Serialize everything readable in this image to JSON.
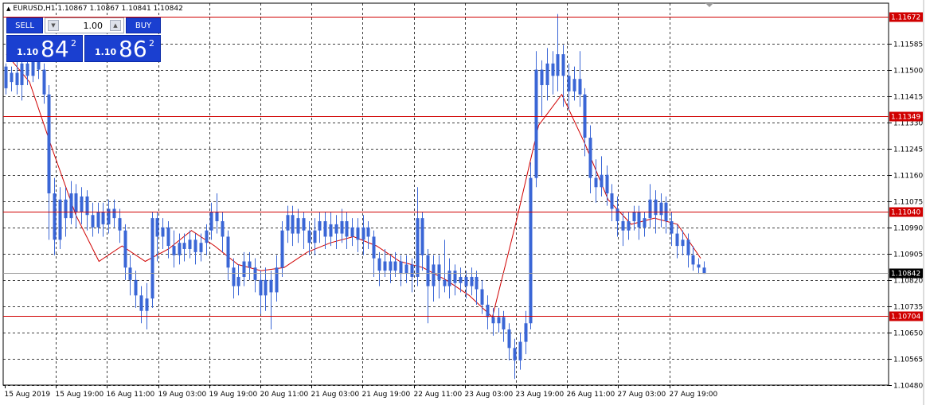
{
  "symbol": {
    "title": "EURUSD,H1  1.10867 1.10867 1.10841 1.10842"
  },
  "one_click": {
    "sell_label": "SELL",
    "buy_label": "BUY",
    "lot": "1.00",
    "sell_prefix": "1.10",
    "sell_big": "84",
    "sell_sup": "2",
    "buy_prefix": "1.10",
    "buy_big": "86",
    "buy_sup": "2"
  },
  "colors": {
    "candle": "#3a66d6",
    "ma": "#d00000",
    "hline": "#d00000",
    "grid": "#000000",
    "current_tag_bg": "#000000"
  },
  "chart_data": {
    "type": "candlestick",
    "symbol": "EURUSD",
    "timeframe": "H1",
    "ylim": [
      1.1048,
      1.11715
    ],
    "y_ticks": [
      "1.11585",
      "1.11500",
      "1.11415",
      "1.11330",
      "1.11245",
      "1.11160",
      "1.11075",
      "1.10990",
      "1.10905",
      "1.10820",
      "1.10735",
      "1.10650",
      "1.10565",
      "1.10480"
    ],
    "x_ticks": [
      "15 Aug 2019",
      "15 Aug 19:00",
      "16 Aug 11:00",
      "19 Aug 03:00",
      "19 Aug 19:00",
      "20 Aug 11:00",
      "21 Aug 03:00",
      "21 Aug 19:00",
      "22 Aug 11:00",
      "23 Aug 03:00",
      "23 Aug 19:00",
      "26 Aug 11:00",
      "27 Aug 03:00",
      "27 Aug 19:00"
    ],
    "grid": true,
    "horizontal_lines": [
      {
        "price": "1.11672"
      },
      {
        "price": "1.11349"
      },
      {
        "price": "1.11040"
      },
      {
        "price": "1.10704"
      }
    ],
    "current_price": "1.10842",
    "moving_average": {
      "color": "red",
      "points": [
        1.1155,
        1.1146,
        1.1124,
        1.1103,
        1.1088,
        1.1093,
        1.1088,
        1.1092,
        1.1098,
        1.1093,
        1.1087,
        1.1085,
        1.1086,
        1.1091,
        1.1094,
        1.1096,
        1.1093,
        1.1088,
        1.1086,
        1.1082,
        1.1077,
        1.107,
        1.11,
        1.1132,
        1.1142,
        1.1126,
        1.1108,
        1.11,
        1.1102,
        1.11,
        1.1089
      ]
    },
    "candles": [
      [
        1.1151,
        1.1144,
        1.1152,
        1.1142
      ],
      [
        1.1146,
        1.1149,
        1.1151,
        1.1143
      ],
      [
        1.1149,
        1.1145,
        1.1155,
        1.1142
      ],
      [
        1.1145,
        1.1152,
        1.1156,
        1.114
      ],
      [
        1.1152,
        1.1148,
        1.1157,
        1.1145
      ],
      [
        1.1148,
        1.1153,
        1.1158,
        1.1146
      ],
      [
        1.1153,
        1.115,
        1.1158,
        1.1147
      ],
      [
        1.115,
        1.1142,
        1.1152,
        1.1139
      ],
      [
        1.1142,
        1.111,
        1.1145,
        1.1095
      ],
      [
        1.111,
        1.1095,
        1.1115,
        1.109
      ],
      [
        1.1095,
        1.1108,
        1.1112,
        1.1092
      ],
      [
        1.1108,
        1.1102,
        1.1112,
        1.1096
      ],
      [
        1.1102,
        1.111,
        1.1114,
        1.11
      ],
      [
        1.111,
        1.1104,
        1.1113,
        1.1099
      ],
      [
        1.1104,
        1.1109,
        1.1112,
        1.11
      ],
      [
        1.1109,
        1.1103,
        1.1111,
        1.1098
      ],
      [
        1.1103,
        1.1099,
        1.1107,
        1.1096
      ],
      [
        1.1099,
        1.1104,
        1.1107,
        1.1097
      ],
      [
        1.1104,
        1.11,
        1.1107,
        1.1096
      ],
      [
        1.11,
        1.1105,
        1.1108,
        1.1097
      ],
      [
        1.1105,
        1.1102,
        1.1108,
        1.1099
      ],
      [
        1.1102,
        1.1098,
        1.1105,
        1.1094
      ],
      [
        1.1098,
        1.1086,
        1.11,
        1.1082
      ],
      [
        1.1086,
        1.1082,
        1.109,
        1.1077
      ],
      [
        1.1082,
        1.1077,
        1.1085,
        1.1073
      ],
      [
        1.1077,
        1.1072,
        1.108,
        1.1068
      ],
      [
        1.1072,
        1.1076,
        1.1081,
        1.1066
      ],
      [
        1.1076,
        1.1102,
        1.1104,
        1.1073
      ],
      [
        1.1102,
        1.1096,
        1.1104,
        1.1088
      ],
      [
        1.1096,
        1.1099,
        1.1102,
        1.1092
      ],
      [
        1.1099,
        1.1093,
        1.1101,
        1.1089
      ],
      [
        1.1093,
        1.109,
        1.1098,
        1.1086
      ],
      [
        1.109,
        1.1094,
        1.1097,
        1.1087
      ],
      [
        1.1094,
        1.1092,
        1.1097,
        1.1088
      ],
      [
        1.1092,
        1.1095,
        1.1098,
        1.1089
      ],
      [
        1.1095,
        1.1091,
        1.1097,
        1.1087
      ],
      [
        1.1091,
        1.1094,
        1.1097,
        1.1088
      ],
      [
        1.1094,
        1.1098,
        1.11,
        1.109
      ],
      [
        1.1098,
        1.1104,
        1.1107,
        1.1095
      ],
      [
        1.1104,
        1.1101,
        1.111,
        1.1097
      ],
      [
        1.1101,
        1.1096,
        1.1104,
        1.1091
      ],
      [
        1.1096,
        1.1086,
        1.1098,
        1.1082
      ],
      [
        1.1086,
        1.108,
        1.1089,
        1.1076
      ],
      [
        1.108,
        1.1083,
        1.1087,
        1.1077
      ],
      [
        1.1083,
        1.1088,
        1.1091,
        1.108
      ],
      [
        1.1088,
        1.1086,
        1.1091,
        1.1082
      ],
      [
        1.1086,
        1.1082,
        1.1089,
        1.1078
      ],
      [
        1.1082,
        1.1077,
        1.1085,
        1.1071
      ],
      [
        1.1077,
        1.1082,
        1.1086,
        1.1072
      ],
      [
        1.1082,
        1.1078,
        1.1085,
        1.1066
      ],
      [
        1.1078,
        1.1086,
        1.109,
        1.1075
      ],
      [
        1.1086,
        1.1098,
        1.1101,
        1.1083
      ],
      [
        1.1098,
        1.1103,
        1.1106,
        1.1094
      ],
      [
        1.1103,
        1.1097,
        1.1106,
        1.1093
      ],
      [
        1.1097,
        1.1102,
        1.1105,
        1.1094
      ],
      [
        1.1102,
        1.1098,
        1.1104,
        1.1092
      ],
      [
        1.1098,
        1.1094,
        1.1101,
        1.109
      ],
      [
        1.1094,
        1.1098,
        1.1102,
        1.109
      ],
      [
        1.1098,
        1.1101,
        1.1104,
        1.1094
      ],
      [
        1.1101,
        1.1096,
        1.1104,
        1.1092
      ],
      [
        1.1096,
        1.11,
        1.1104,
        1.1093
      ],
      [
        1.11,
        1.1097,
        1.1103,
        1.1092
      ],
      [
        1.1097,
        1.1101,
        1.1105,
        1.1094
      ],
      [
        1.1101,
        1.1096,
        1.1104,
        1.1092
      ],
      [
        1.1096,
        1.1099,
        1.1102,
        1.1093
      ],
      [
        1.1099,
        1.1095,
        1.1102,
        1.1091
      ],
      [
        1.1095,
        1.1099,
        1.1103,
        1.109
      ],
      [
        1.1099,
        1.1096,
        1.1101,
        1.1092
      ],
      [
        1.1096,
        1.1089,
        1.1098,
        1.1083
      ],
      [
        1.1089,
        1.1085,
        1.1091,
        1.108
      ],
      [
        1.1085,
        1.1088,
        1.1092,
        1.1083
      ],
      [
        1.1088,
        1.1085,
        1.109,
        1.1081
      ],
      [
        1.1085,
        1.1088,
        1.1091,
        1.1083
      ],
      [
        1.1088,
        1.1084,
        1.109,
        1.108
      ],
      [
        1.1084,
        1.1087,
        1.109,
        1.1081
      ],
      [
        1.1087,
        1.1083,
        1.1089,
        1.1078
      ],
      [
        1.1083,
        1.1102,
        1.1112,
        1.108
      ],
      [
        1.1102,
        1.109,
        1.1104,
        1.1085
      ],
      [
        1.109,
        1.108,
        1.1092,
        1.1068
      ],
      [
        1.108,
        1.1087,
        1.109,
        1.1075
      ],
      [
        1.1087,
        1.1082,
        1.109,
        1.1076
      ],
      [
        1.1082,
        1.108,
        1.1095,
        1.1078
      ],
      [
        1.108,
        1.1085,
        1.1089,
        1.1076
      ],
      [
        1.1085,
        1.1081,
        1.1087,
        1.1077
      ],
      [
        1.1081,
        1.1083,
        1.1086,
        1.1078
      ],
      [
        1.1083,
        1.108,
        1.1085,
        1.1076
      ],
      [
        1.108,
        1.1083,
        1.1086,
        1.1077
      ],
      [
        1.1083,
        1.1079,
        1.1085,
        1.1074
      ],
      [
        1.1079,
        1.1074,
        1.1082,
        1.1071
      ],
      [
        1.1074,
        1.107,
        1.1077,
        1.1066
      ],
      [
        1.107,
        1.1068,
        1.1073,
        1.1064
      ],
      [
        1.1068,
        1.107,
        1.1073,
        1.1065
      ],
      [
        1.107,
        1.1066,
        1.1072,
        1.1062
      ],
      [
        1.1066,
        1.106,
        1.1068,
        1.1056
      ],
      [
        1.106,
        1.1056,
        1.1063,
        1.105
      ],
      [
        1.1056,
        1.1062,
        1.1065,
        1.1053
      ],
      [
        1.1062,
        1.1068,
        1.1072,
        1.1058
      ],
      [
        1.1068,
        1.1115,
        1.112,
        1.1066
      ],
      [
        1.1115,
        1.115,
        1.1156,
        1.1112
      ],
      [
        1.115,
        1.1145,
        1.1153,
        1.1135
      ],
      [
        1.1145,
        1.1152,
        1.1157,
        1.114
      ],
      [
        1.1152,
        1.1148,
        1.1156,
        1.1142
      ],
      [
        1.1148,
        1.1155,
        1.1168,
        1.1143
      ],
      [
        1.1155,
        1.1148,
        1.1158,
        1.1138
      ],
      [
        1.1148,
        1.1143,
        1.1152,
        1.1137
      ],
      [
        1.1143,
        1.1147,
        1.1151,
        1.114
      ],
      [
        1.1147,
        1.1142,
        1.1156,
        1.1138
      ],
      [
        1.1142,
        1.1128,
        1.1144,
        1.1122
      ],
      [
        1.1128,
        1.1115,
        1.1132,
        1.111
      ],
      [
        1.1115,
        1.1112,
        1.1121,
        1.1107
      ],
      [
        1.1112,
        1.1116,
        1.1122,
        1.1109
      ],
      [
        1.1116,
        1.111,
        1.1119,
        1.1106
      ],
      [
        1.111,
        1.1105,
        1.1113,
        1.1101
      ],
      [
        1.1105,
        1.1101,
        1.1109,
        1.1096
      ],
      [
        1.1101,
        1.1098,
        1.1104,
        1.1093
      ],
      [
        1.1098,
        1.1101,
        1.1104,
        1.1095
      ],
      [
        1.1101,
        1.1104,
        1.1106,
        1.1098
      ],
      [
        1.1104,
        1.1099,
        1.1106,
        1.1095
      ],
      [
        1.1099,
        1.1102,
        1.1104,
        1.1096
      ],
      [
        1.1102,
        1.1108,
        1.1113,
        1.1099
      ],
      [
        1.1108,
        1.1103,
        1.1111,
        1.1097
      ],
      [
        1.1103,
        1.1107,
        1.111,
        1.1099
      ],
      [
        1.1107,
        1.1101,
        1.1109,
        1.1097
      ],
      [
        1.1101,
        1.1097,
        1.1104,
        1.1093
      ],
      [
        1.1097,
        1.1093,
        1.11,
        1.1089
      ],
      [
        1.1093,
        1.1095,
        1.1098,
        1.109
      ],
      [
        1.1095,
        1.109,
        1.1097,
        1.1086
      ],
      [
        1.109,
        1.1087,
        1.1093,
        1.1085
      ],
      [
        1.1087,
        1.1086,
        1.1089,
        1.1084
      ],
      [
        1.1086,
        1.1084,
        1.1088,
        1.1084
      ]
    ]
  }
}
